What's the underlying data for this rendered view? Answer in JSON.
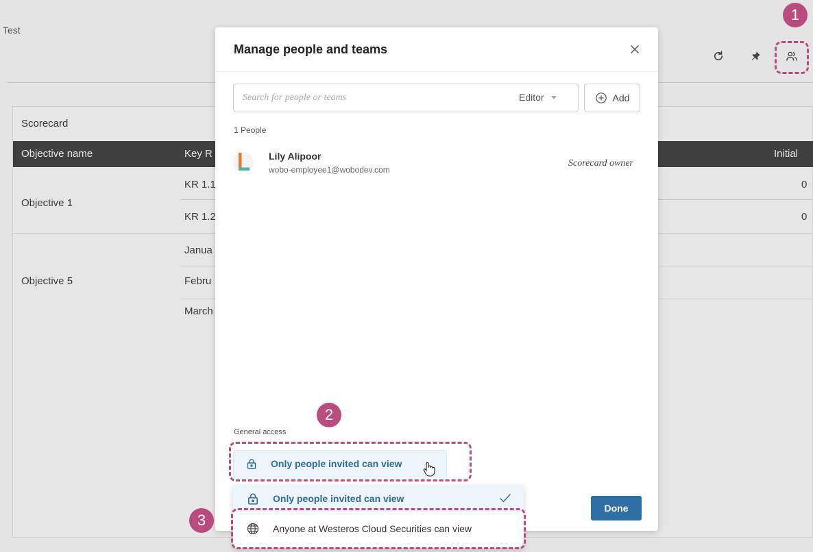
{
  "page": {
    "title": "Test"
  },
  "header_icons": {
    "refresh": "refresh-icon",
    "pin": "pin-icon",
    "people": "people-icon"
  },
  "scorecard": {
    "title": "Scorecard",
    "columns": [
      "Objective name",
      "Key R",
      "Initial"
    ],
    "rows": [
      {
        "objective": "Objective 1",
        "key_results": [
          "KR 1.1",
          "KR 1.2"
        ],
        "initial": [
          "0",
          "0"
        ]
      },
      {
        "objective": "Objective 5",
        "key_results": [
          "Janua",
          "Febru",
          "March"
        ]
      }
    ]
  },
  "modal": {
    "title": "Manage people and teams",
    "search": {
      "placeholder": "Search for people or teams",
      "role": "Editor"
    },
    "add_label": "Add",
    "people_count": "1 People",
    "people": [
      {
        "name": "Lily Alipoor",
        "email": "wobo-employee1@wobodev.com",
        "role": "Scorecard owner"
      }
    ],
    "general_access": {
      "label": "General access",
      "current": "Only people invited can view",
      "options": [
        "Only people invited can view",
        "Anyone at Westeros Cloud Securities can view"
      ]
    },
    "done_label": "Done"
  },
  "annotations": [
    "1",
    "2",
    "3"
  ],
  "colors": {
    "annotation": "#b94c7c",
    "primary": "#2e6fa6",
    "selected_bg": "#edf5fb",
    "table_header": "#404040"
  }
}
